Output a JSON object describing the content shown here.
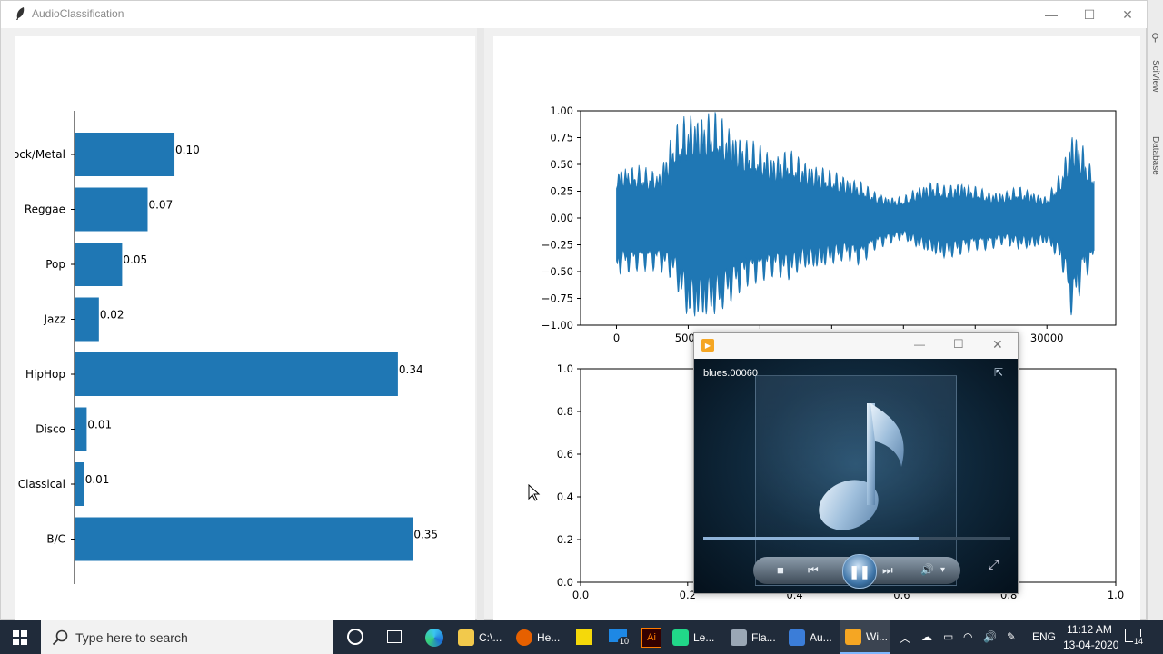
{
  "window": {
    "title": "AudioClassification",
    "controls": {
      "minimize": "—",
      "maximize": "☐",
      "close": "✕"
    }
  },
  "bar_chart": {
    "categories": [
      "Rock/Metal",
      "Reggae",
      "Pop",
      "Jazz",
      "HipHop",
      "Disco",
      "Classical",
      "B/C"
    ],
    "displayed_labels": [
      "ock/Metal",
      "Reggae",
      "Pop",
      "Jazz",
      "HipHop",
      "Disco",
      "Classical",
      "B/C"
    ],
    "value_labels": [
      "0.10",
      "0.07",
      "0.05",
      "0.02",
      "0.34",
      "0.01",
      "0.01",
      "0.35"
    ],
    "color": "#1f77b4"
  },
  "chart_data": [
    {
      "type": "bar",
      "orientation": "horizontal",
      "categories": [
        "Rock/Metal",
        "Reggae",
        "Pop",
        "Jazz",
        "HipHop",
        "Disco",
        "Classical",
        "B/C"
      ],
      "values": [
        0.105,
        0.0768,
        0.05,
        0.0256,
        0.3396,
        0.0128,
        0.0102,
        0.3553
      ],
      "data_labels": [
        "0.10",
        "0.07",
        "0.05",
        "0.02",
        "0.34",
        "0.01",
        "0.01",
        "0.35"
      ],
      "color": "#1f77b4"
    },
    {
      "type": "line",
      "x_ticks": [
        "0",
        "5000",
        "",
        "",
        "",
        "",
        "30000"
      ],
      "y_ticks": [
        "1.00",
        "0.75",
        "0.50",
        "0.25",
        "0.00",
        "−0.25",
        "−0.50",
        "−0.75",
        "−1.00"
      ],
      "xlim": [
        -2500,
        34800
      ],
      "ylim": [
        -1,
        1
      ],
      "series_color": "#1f77b4",
      "envelope": [
        {
          "x": 0,
          "hi": 0.5,
          "lo": -0.55
        },
        {
          "x": 1500,
          "hi": 0.5,
          "lo": -0.5
        },
        {
          "x": 3000,
          "hi": 0.45,
          "lo": -0.5
        },
        {
          "x": 4000,
          "hi": 0.85,
          "lo": -0.6
        },
        {
          "x": 5000,
          "hi": 1.0,
          "lo": -1.0
        },
        {
          "x": 6000,
          "hi": 1.0,
          "lo": -1.0
        },
        {
          "x": 7000,
          "hi": 1.0,
          "lo": -0.95
        },
        {
          "x": 8000,
          "hi": 0.85,
          "lo": -0.8
        },
        {
          "x": 9000,
          "hi": 0.75,
          "lo": -0.65
        },
        {
          "x": 10000,
          "hi": 0.7,
          "lo": -0.6
        },
        {
          "x": 11000,
          "hi": 0.6,
          "lo": -0.55
        },
        {
          "x": 12000,
          "hi": 0.65,
          "lo": -0.6
        },
        {
          "x": 13000,
          "hi": 0.55,
          "lo": -0.5
        },
        {
          "x": 14000,
          "hi": 0.5,
          "lo": -0.5
        },
        {
          "x": 15000,
          "hi": 0.45,
          "lo": -0.45
        },
        {
          "x": 16000,
          "hi": 0.4,
          "lo": -0.4
        },
        {
          "x": 17000,
          "hi": 0.35,
          "lo": -0.45
        },
        {
          "x": 18000,
          "hi": 0.25,
          "lo": -0.3
        },
        {
          "x": 19000,
          "hi": 0.2,
          "lo": -0.25
        },
        {
          "x": 20000,
          "hi": 0.2,
          "lo": -0.2
        },
        {
          "x": 21000,
          "hi": 0.3,
          "lo": -0.3
        },
        {
          "x": 22000,
          "hi": 0.35,
          "lo": -0.35
        },
        {
          "x": 23000,
          "hi": 0.3,
          "lo": -0.4
        },
        {
          "x": 24000,
          "hi": 0.35,
          "lo": -0.35
        },
        {
          "x": 25000,
          "hi": 0.3,
          "lo": -0.3
        },
        {
          "x": 26000,
          "hi": 0.25,
          "lo": -0.3
        },
        {
          "x": 27000,
          "hi": 0.25,
          "lo": -0.25
        },
        {
          "x": 28000,
          "hi": 0.3,
          "lo": -0.3
        },
        {
          "x": 29000,
          "hi": 0.25,
          "lo": -0.3
        },
        {
          "x": 30000,
          "hi": 0.2,
          "lo": -0.25
        },
        {
          "x": 31000,
          "hi": 0.45,
          "lo": -0.45
        },
        {
          "x": 31800,
          "hi": 0.85,
          "lo": -1.0
        },
        {
          "x": 32500,
          "hi": 0.7,
          "lo": -0.6
        },
        {
          "x": 33000,
          "hi": 0.5,
          "lo": -0.5
        },
        {
          "x": 33300,
          "hi": 0.5,
          "lo": -0.5
        }
      ]
    },
    {
      "type": "line",
      "x_ticks": [
        "0.0",
        "0.2",
        "0.4",
        "0.6",
        "0.8",
        "1.0"
      ],
      "y_ticks": [
        "1.0",
        "0.8",
        "0.6",
        "0.4",
        "0.2",
        "0.0"
      ],
      "xlim": [
        0,
        1
      ],
      "ylim": [
        0,
        1
      ]
    }
  ],
  "media_player": {
    "track": "blues.00060",
    "progress": 0.7,
    "controls": {
      "stop": "■",
      "prev": "⏮",
      "pause": "❚❚",
      "next": "⏭",
      "volume": "🔊",
      "volume_arrow": "▾",
      "switch": "⇱",
      "fullscreen": "⤢"
    },
    "window_controls": {
      "minimize": "—",
      "maximize": "☐",
      "close": "✕"
    }
  },
  "ide_strip": {
    "tab1": "SciView",
    "tab2": "Database"
  },
  "taskbar": {
    "search_placeholder": "Type here to search",
    "items": [
      {
        "label": "C:\\...",
        "icon": "folder-icon",
        "color": "#f2c94c"
      },
      {
        "label": "He...",
        "icon": "firefox-icon",
        "color": "#e66000"
      },
      {
        "label": "Le...",
        "icon": "pycharm-icon",
        "color": "#21d789"
      },
      {
        "label": "Fla...",
        "icon": "window-icon",
        "color": "#9aa7b5"
      },
      {
        "label": "Au...",
        "icon": "feather-icon",
        "color": "#3b7dd8"
      },
      {
        "label": "Wi...",
        "icon": "media-player-icon",
        "color": "#f5a623"
      }
    ],
    "mail_badge": "10",
    "language": "ENG",
    "time": "11:12 AM",
    "date": "13-04-2020",
    "notification_count": "14"
  }
}
